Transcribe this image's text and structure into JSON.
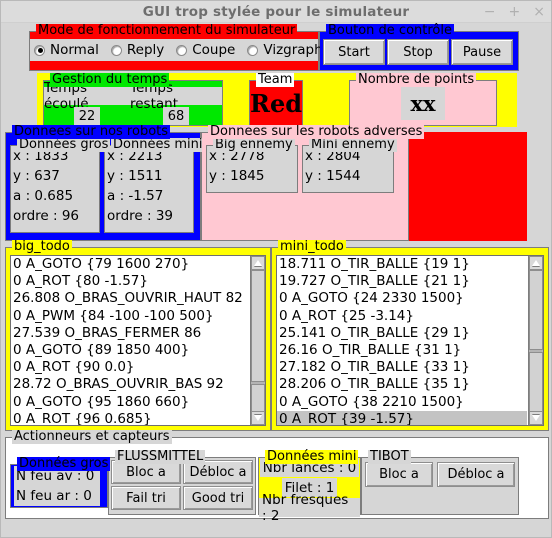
{
  "window": {
    "title": "GUI trop stylée pour le simulateur",
    "minimize_icon": "minimize-icon",
    "maximize_icon": "maximize-icon",
    "close_icon": "close-icon",
    "minimize_glyph": "−",
    "maximize_glyph": "+",
    "close_glyph": "×"
  },
  "mode_frame": {
    "title": "Mode de fonctionnement du simulateur",
    "options": [
      {
        "label": "Normal",
        "selected": true
      },
      {
        "label": "Reply",
        "selected": false
      },
      {
        "label": "Coupe",
        "selected": false
      },
      {
        "label": "Vizgraph",
        "selected": false
      }
    ]
  },
  "control_frame": {
    "title": "Bouton de contrôle",
    "buttons": [
      "Start",
      "Stop",
      "Pause"
    ]
  },
  "time_frame": {
    "title": "Gestion du temps",
    "elapsed_label": "Temps écoulé",
    "remaining_label": "Temps restant",
    "elapsed_value": "22",
    "remaining_value": "68"
  },
  "team_frame": {
    "title": "Team",
    "value": "Red"
  },
  "points_frame": {
    "title": "Nombre de points",
    "value": "xx"
  },
  "our_robots": {
    "title": "Donnees sur nos robots",
    "big": {
      "title": "Données gros",
      "rows": [
        "x : 1833",
        " y : 637",
        "a : 0.685",
        "ordre : 96"
      ]
    },
    "mini": {
      "title": "Données mini",
      "rows": [
        "x : 2213",
        "y : 1511",
        "a : -1.57",
        "ordre : 39"
      ]
    }
  },
  "enemy_robots": {
    "title": "Donnees sur les robots adverses",
    "big": {
      "title": "Big ennemy",
      "rows": [
        "x : 2778",
        "y : 1845"
      ]
    },
    "mini": {
      "title": "Mini ennemy",
      "rows": [
        "x : 2804",
        "y : 1544"
      ]
    }
  },
  "big_todo": {
    "title": "big_todo",
    "items": [
      "0 A_GOTO {79 1600 270}",
      "0 A_ROT {80 -1.57}",
      "26.808 O_BRAS_OUVRIR_HAUT 82",
      "0 A_PWM {84 -100 -100 500}",
      "27.539 O_BRAS_FERMER 86",
      "0 A_GOTO {89 1850 400}",
      "0 A_ROT {90 0.0}",
      "28.72 O_BRAS_OUVRIR_BAS 92",
      "0 A_GOTO {95 1860 660}",
      "0 A_ROT {96 0.685}"
    ],
    "selected_index": -1
  },
  "mini_todo": {
    "title": "mini_todo",
    "items": [
      "18.711 O_TIR_BALLE {19 1}",
      "19.727 O_TIR_BALLE {21 1}",
      "0 A_GOTO {24 2330 1500}",
      "0 A_ROT {25 -3.14}",
      "25.141 O_TIR_BALLE {29 1}",
      "26.16 O_TIR_BALLE {31 1}",
      "27.182 O_TIR_BALLE {33 1}",
      "28.206 O_TIR_BALLE {35 1}",
      "0 A_GOTO {38 2210 1500}",
      "0 A_ROT {39 -1.57}"
    ],
    "selected_index": 9
  },
  "actuators": {
    "title": "Actionneurs et capteurs",
    "gros": {
      "title": "Données gros",
      "rows": [
        "N feu av : 0",
        "N feu ar : 0"
      ]
    },
    "flussmittel": {
      "title": "FLUSSMITTEL",
      "buttons": [
        "Bloc a",
        "Débloc a",
        "Fail tri",
        "Good tri"
      ]
    },
    "donnees_mini": {
      "title": "Données mini",
      "rows": [
        "Nbr lances : 0",
        "Filet : 1",
        "Nbr fresques : 2"
      ]
    },
    "tibot": {
      "title": "TIBOT",
      "buttons": [
        "Bloc a",
        "Débloc a"
      ]
    }
  },
  "colors": {
    "red": "#ff0000",
    "blue": "#0000ff",
    "green": "#00e800",
    "yellow": "#ffff00",
    "pink": "#ffc8d2",
    "grey": "#d6d6d6"
  }
}
